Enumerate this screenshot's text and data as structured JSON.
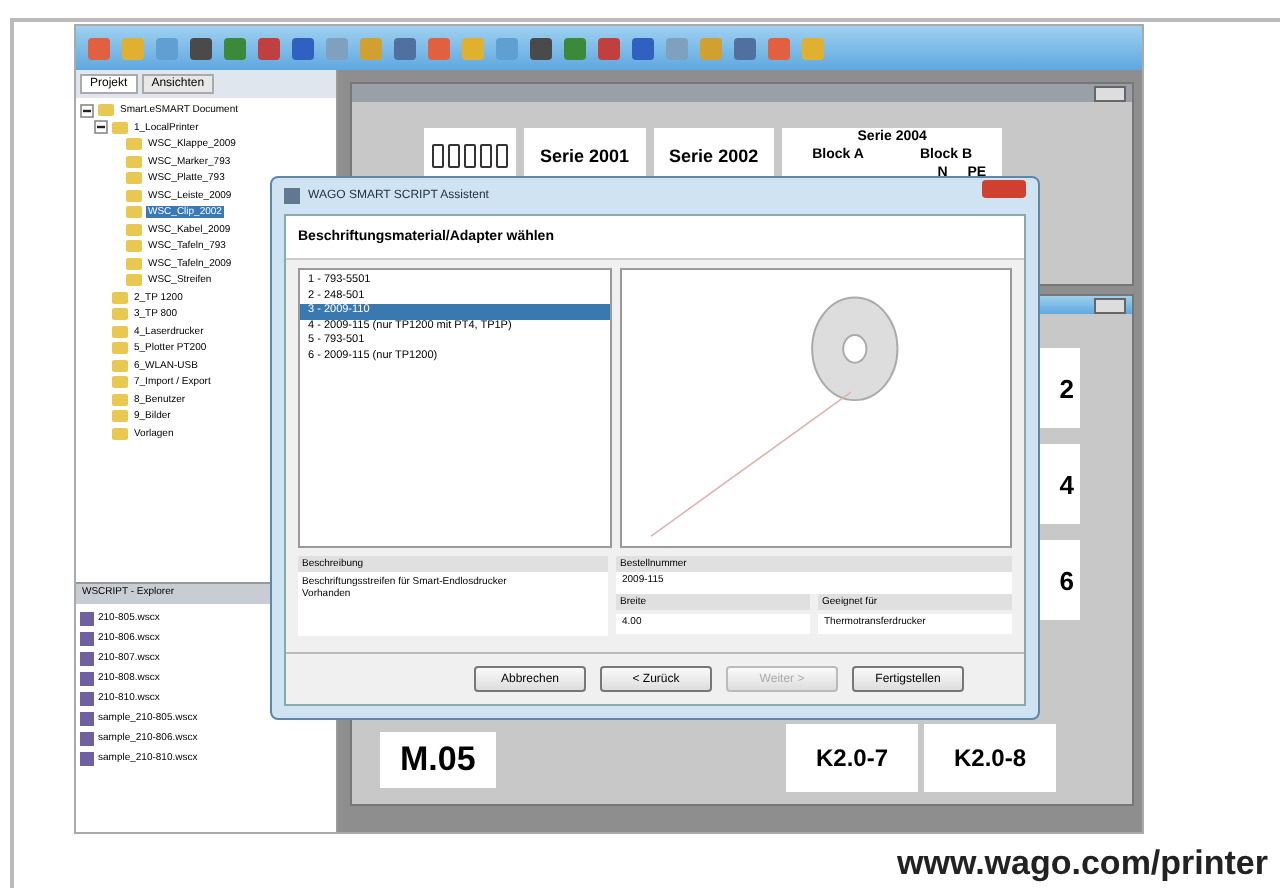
{
  "project_tabs": [
    {
      "label": "Projekt",
      "selected": true
    },
    {
      "label": "Ansichten",
      "selected": false
    }
  ],
  "tree": [
    {
      "label": "Smart.eSMART Document",
      "expanded": true,
      "selected": false,
      "children": [
        {
          "label": "1_LocalPrinter",
          "expanded": true,
          "selected": false,
          "children": [
            {
              "label": "WSC_Klappe_2009",
              "selected": false
            },
            {
              "label": "WSC_Marker_793",
              "selected": false
            },
            {
              "label": "WSC_Platte_793",
              "selected": false
            },
            {
              "label": "WSC_Leiste_2009",
              "selected": false
            },
            {
              "label": "WSC_Clip_2002",
              "selected": true
            },
            {
              "label": "WSC_Kabel_2009",
              "selected": false
            },
            {
              "label": "WSC_Tafeln_793",
              "selected": false
            },
            {
              "label": "WSC_Tafeln_2009",
              "selected": false
            },
            {
              "label": "WSC_Streifen",
              "selected": false
            }
          ]
        },
        {
          "label": "2_TP 1200",
          "selected": false
        },
        {
          "label": "3_TP 800",
          "selected": false
        },
        {
          "label": "4_Laserdrucker",
          "selected": false
        },
        {
          "label": "5_Plotter PT200",
          "selected": false
        },
        {
          "label": "6_WLAN-USB",
          "selected": false
        },
        {
          "label": "7_Import / Export",
          "selected": false
        },
        {
          "label": "8_Benutzer",
          "selected": false
        },
        {
          "label": "9_Bilder",
          "selected": false
        },
        {
          "label": "Vorlagen",
          "selected": false
        }
      ]
    }
  ],
  "explorer": {
    "title": "WSCRIPT - Explorer",
    "files": [
      "210-805.wscx",
      "210-806.wscx",
      "210-807.wscx",
      "210-808.wscx",
      "210-810.wscx",
      "sample_210-805.wscx",
      "sample_210-806.wscx",
      "sample_210-810.wscx"
    ]
  },
  "document_top": {
    "headers": [
      "Serie 2001",
      "Serie 2002"
    ],
    "group": "Serie 2004",
    "blocks": [
      "Block A",
      "Block B"
    ],
    "cells": [
      "N",
      "PE"
    ]
  },
  "document_bottom": {
    "right_cells": [
      "2",
      "4",
      "6"
    ],
    "label_left": "M.05",
    "labels_bottom": [
      "K2.0-7",
      "K2.0-8"
    ]
  },
  "dialog": {
    "title": "WAGO SMART SCRIPT Assistent",
    "heading": "Beschriftungsmaterial/Adapter wählen",
    "options": [
      {
        "label": "1 - 793-5501",
        "selected": false
      },
      {
        "label": "2 - 248-501",
        "selected": false
      },
      {
        "label": "3 - 2009-110",
        "selected": true
      },
      {
        "label": "4 - 2009-115 (nur TP1200 mit PT4, TP1P)",
        "selected": false
      },
      {
        "label": "5 - 793-501",
        "selected": false
      },
      {
        "label": "6 - 2009-115 (nur TP1200)",
        "selected": false
      }
    ],
    "description_label": "Beschreibung",
    "description": "Beschriftungsstreifen für Smart-Endlosdrucker",
    "description_note": "Vorhanden",
    "order_label": "Bestellnummer",
    "order_value": "2009-115",
    "width_label": "Breite",
    "width_value": "4.00",
    "suitable_label": "Geeignet für",
    "suitable_value": "Thermotransferdrucker",
    "buttons": [
      {
        "label": "Abbrechen",
        "disabled": false
      },
      {
        "label": "< Zurück",
        "disabled": false
      },
      {
        "label": "Weiter >",
        "disabled": true
      },
      {
        "label": "Fertigstellen",
        "disabled": false
      }
    ]
  },
  "caption": "www.wago.com/printer"
}
